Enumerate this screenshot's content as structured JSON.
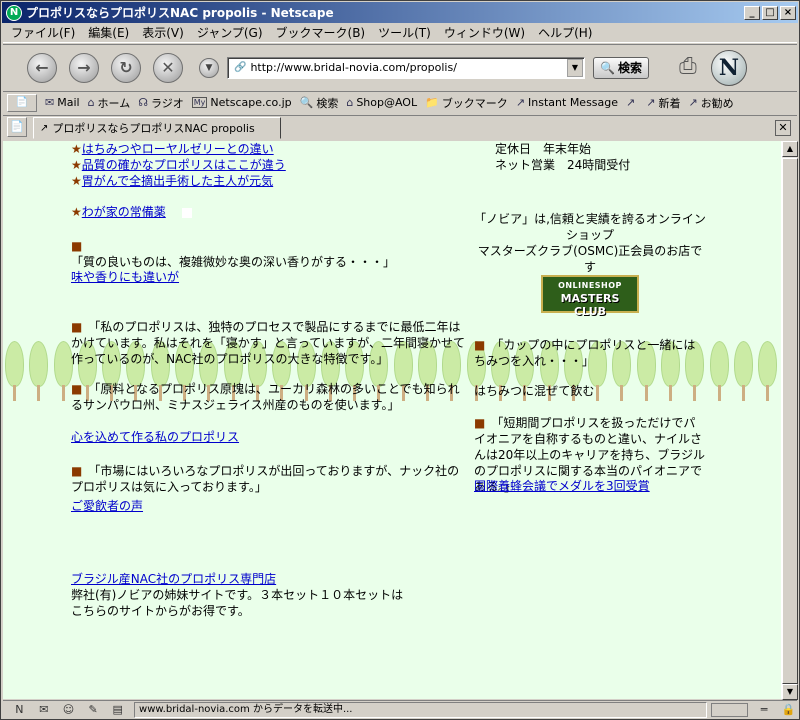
{
  "window": {
    "title": "プロポリスならプロポリスNAC  propolis - Netscape",
    "min_label": "_",
    "max_label": "□",
    "close_label": "×"
  },
  "menu": [
    "ファイル(F)",
    "編集(E)",
    "表示(V)",
    "ジャンプ(G)",
    "ブックマーク(B)",
    "ツール(T)",
    "ウィンドウ(W)",
    "ヘルプ(H)"
  ],
  "nav": {
    "url": "http://www.bridal-novia.com/propolis/",
    "search_label": "検索",
    "logo_letter": "N"
  },
  "personal_toolbar": [
    {
      "icon": "mail-icon",
      "label": "Mail"
    },
    {
      "icon": "home-icon",
      "label": "ホーム"
    },
    {
      "icon": "radio-icon",
      "label": "ラジオ"
    },
    {
      "icon": "my-icon",
      "label": "Netscape.co.jp"
    },
    {
      "icon": "search-icon",
      "label": "検索"
    },
    {
      "icon": "shop-icon",
      "label": "Shop@AOL"
    },
    {
      "icon": "bookmark-icon",
      "label": "ブックマーク"
    },
    {
      "icon": "im-icon",
      "label": "Instant Message"
    },
    {
      "icon": "link-icon",
      "label": ""
    },
    {
      "icon": "link-icon",
      "label": "新着"
    },
    {
      "icon": "link-icon",
      "label": "お勧め"
    }
  ],
  "tab": {
    "label": "プロポリスならプロポリスNAC  propolis"
  },
  "page": {
    "link1": "はちみつやローヤルゼリーとの違い",
    "link2": "品質の確かなプロポリスはここが違う",
    "link3": "胃がんで全摘出手術した主人が元気",
    "link4": "わが家の常備薬",
    "para1": "「質の良いものは、複雑微妙な奥の深い香りがする・・・」",
    "link5": "味や香りにも違いが",
    "para2": "「私のプロポリスは、独特のプロセスで製品にするまでに最低二年はかけています。私はそれを「寝かす」と言っていますが、二年間寝かせて作っているのが、NAC社のプロポリスの大きな特徴です。」",
    "para3": "「原料となるプロポリス原塊は、ユーカリ森林の多いことでも知られるサンパウロ州、ミナスジェライス州産のものを使います。」",
    "link6": "心を込めて作る私のプロポリス",
    "para4": "「市場にはいろいろなプロポリスが出回っておりますが、ナック社のプロポリスは気に入っております。」",
    "link7": "ご愛飲者の声",
    "link8": "ブラジル産NAC社のプロポリス専門店",
    "para5_line1": "弊社(有)ノビアの姉妹サイトです。３本セット１０本セットは",
    "para5_line2": "こちらのサイトからがお得です。",
    "right_holiday": "定休日　年末年始",
    "right_online": "ネット営業　24時間受付",
    "right_osmc": "「ノビア」は,信頼と実績を誇るオンラインショップ\nマスターズクラブ(OSMC)正会員のお店です",
    "logo_line1": "ONLINESHOP",
    "logo_line2": "MASTERS CLUB",
    "right_para1": "「カップの中にプロポリスと一緒にはちみつを入れ・・・」",
    "right_text1": "はちみつに混ぜて飲む",
    "right_para2": "「短期間プロポリスを扱っただけでパイオニアを自称するものと違い、ナイルさんは20年以上のキャリアを持ち、ブラジルのプロポリスに関する本当のパイオニアである。」",
    "right_link1": "国際養蜂会議でメダルを3回受賞"
  },
  "status": {
    "message": "www.bridal-novia.com からデータを転送中..."
  }
}
